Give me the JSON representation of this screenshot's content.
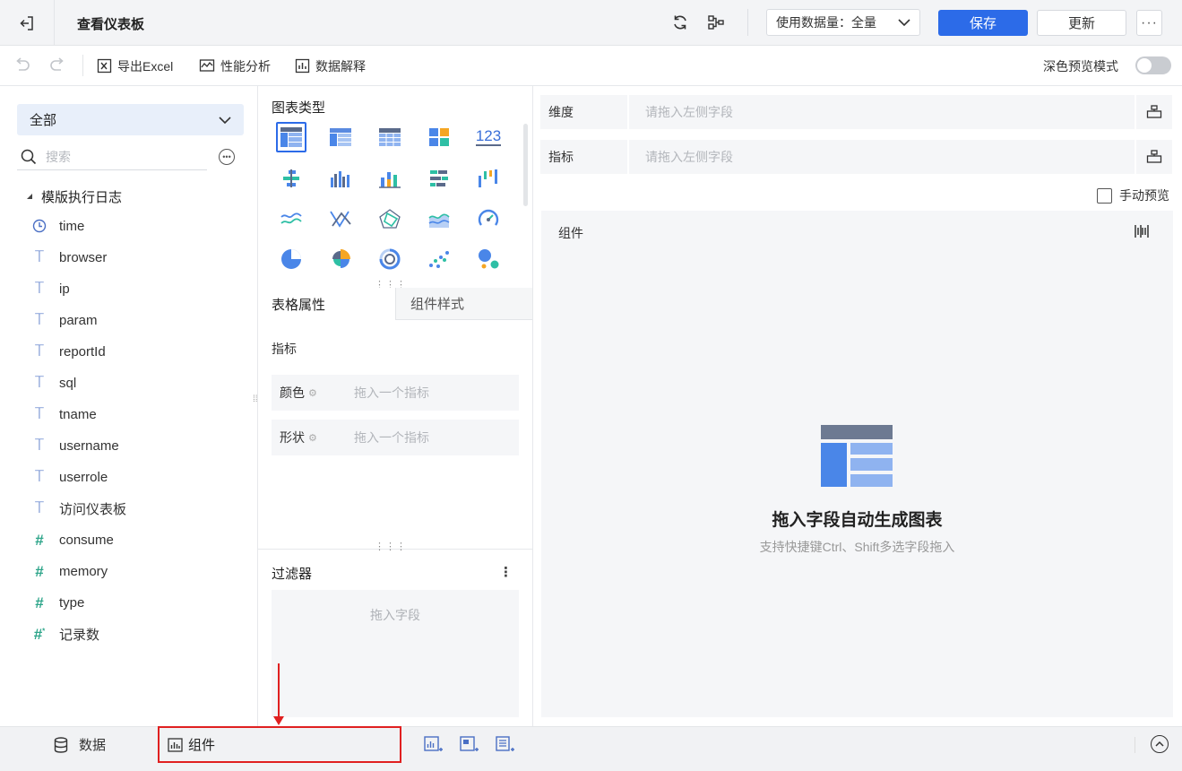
{
  "header": {
    "title": "查看仪表板",
    "data_select_label": "使用数据量：全量",
    "save_label": "保存",
    "update_label": "更新",
    "more_label": "···"
  },
  "toolbar": {
    "export_label": "导出Excel",
    "perf_label": "性能分析",
    "explain_label": "数据解释",
    "dark_mode_label": "深色预览模式",
    "dark_mode_on": false
  },
  "left_panel": {
    "dataset_select": "全部",
    "search_placeholder": "搜索",
    "tree_root": "模版执行日志",
    "fields": [
      {
        "name": "time",
        "type": "time-icon"
      },
      {
        "name": "browser",
        "type": "text-icon"
      },
      {
        "name": "ip",
        "type": "text-icon"
      },
      {
        "name": "param",
        "type": "text-icon"
      },
      {
        "name": "reportId",
        "type": "text-icon"
      },
      {
        "name": "sql",
        "type": "text-icon"
      },
      {
        "name": "tname",
        "type": "text-icon"
      },
      {
        "name": "username",
        "type": "text-icon"
      },
      {
        "name": "userrole",
        "type": "text-icon"
      },
      {
        "name": "访问仪表板",
        "type": "text-icon"
      },
      {
        "name": "consume",
        "type": "number-icon"
      },
      {
        "name": "memory",
        "type": "number-icon"
      },
      {
        "name": "type",
        "type": "number-icon"
      },
      {
        "name": "记录数",
        "type": "number-calc-icon"
      }
    ]
  },
  "middle_panel": {
    "chart_type_title": "图表类型",
    "chart_types": [
      "grouped-table-icon",
      "detail-table-icon",
      "cross-table-icon",
      "kpi-card-icon",
      "number-123-icon",
      "bar-h-icon",
      "bar-group-icon",
      "bar-stack-icon",
      "bar-h-stack-icon",
      "waterfall-icon",
      "line-icon",
      "parallel-icon",
      "radar-icon",
      "area-icon",
      "gauge-icon",
      "pie-icon",
      "rose-pie-icon",
      "donut-icon",
      "scatter-icon",
      "bubble-icon"
    ],
    "chart_type_number_label": "123",
    "tab_table": "表格属性",
    "tab_style": "组件样式",
    "metric_section": "指标",
    "color_label": "颜色",
    "color_placeholder": "拖入一个指标",
    "shape_label": "形状",
    "shape_placeholder": "拖入一个指标",
    "filter_title": "过滤器",
    "filter_placeholder": "拖入字段"
  },
  "right_panel": {
    "dimension_label": "维度",
    "dimension_placeholder": "请拖入左侧字段",
    "metric_label": "指标",
    "metric_placeholder": "请拖入左侧字段",
    "manual_preview_label": "手动预览",
    "component_label": "组件",
    "empty_title": "拖入字段自动生成图表",
    "empty_subtitle": "支持快捷键Ctrl、Shift多选字段拖入"
  },
  "bottom_bar": {
    "data_tab": "数据",
    "component_tab": "组件"
  },
  "colors": {
    "primary": "#2c6be8",
    "highlight_border": "#e02020",
    "chart_blue": "#4a86e8",
    "chart_orange": "#f5a623",
    "chart_teal": "#2ebfa5"
  }
}
